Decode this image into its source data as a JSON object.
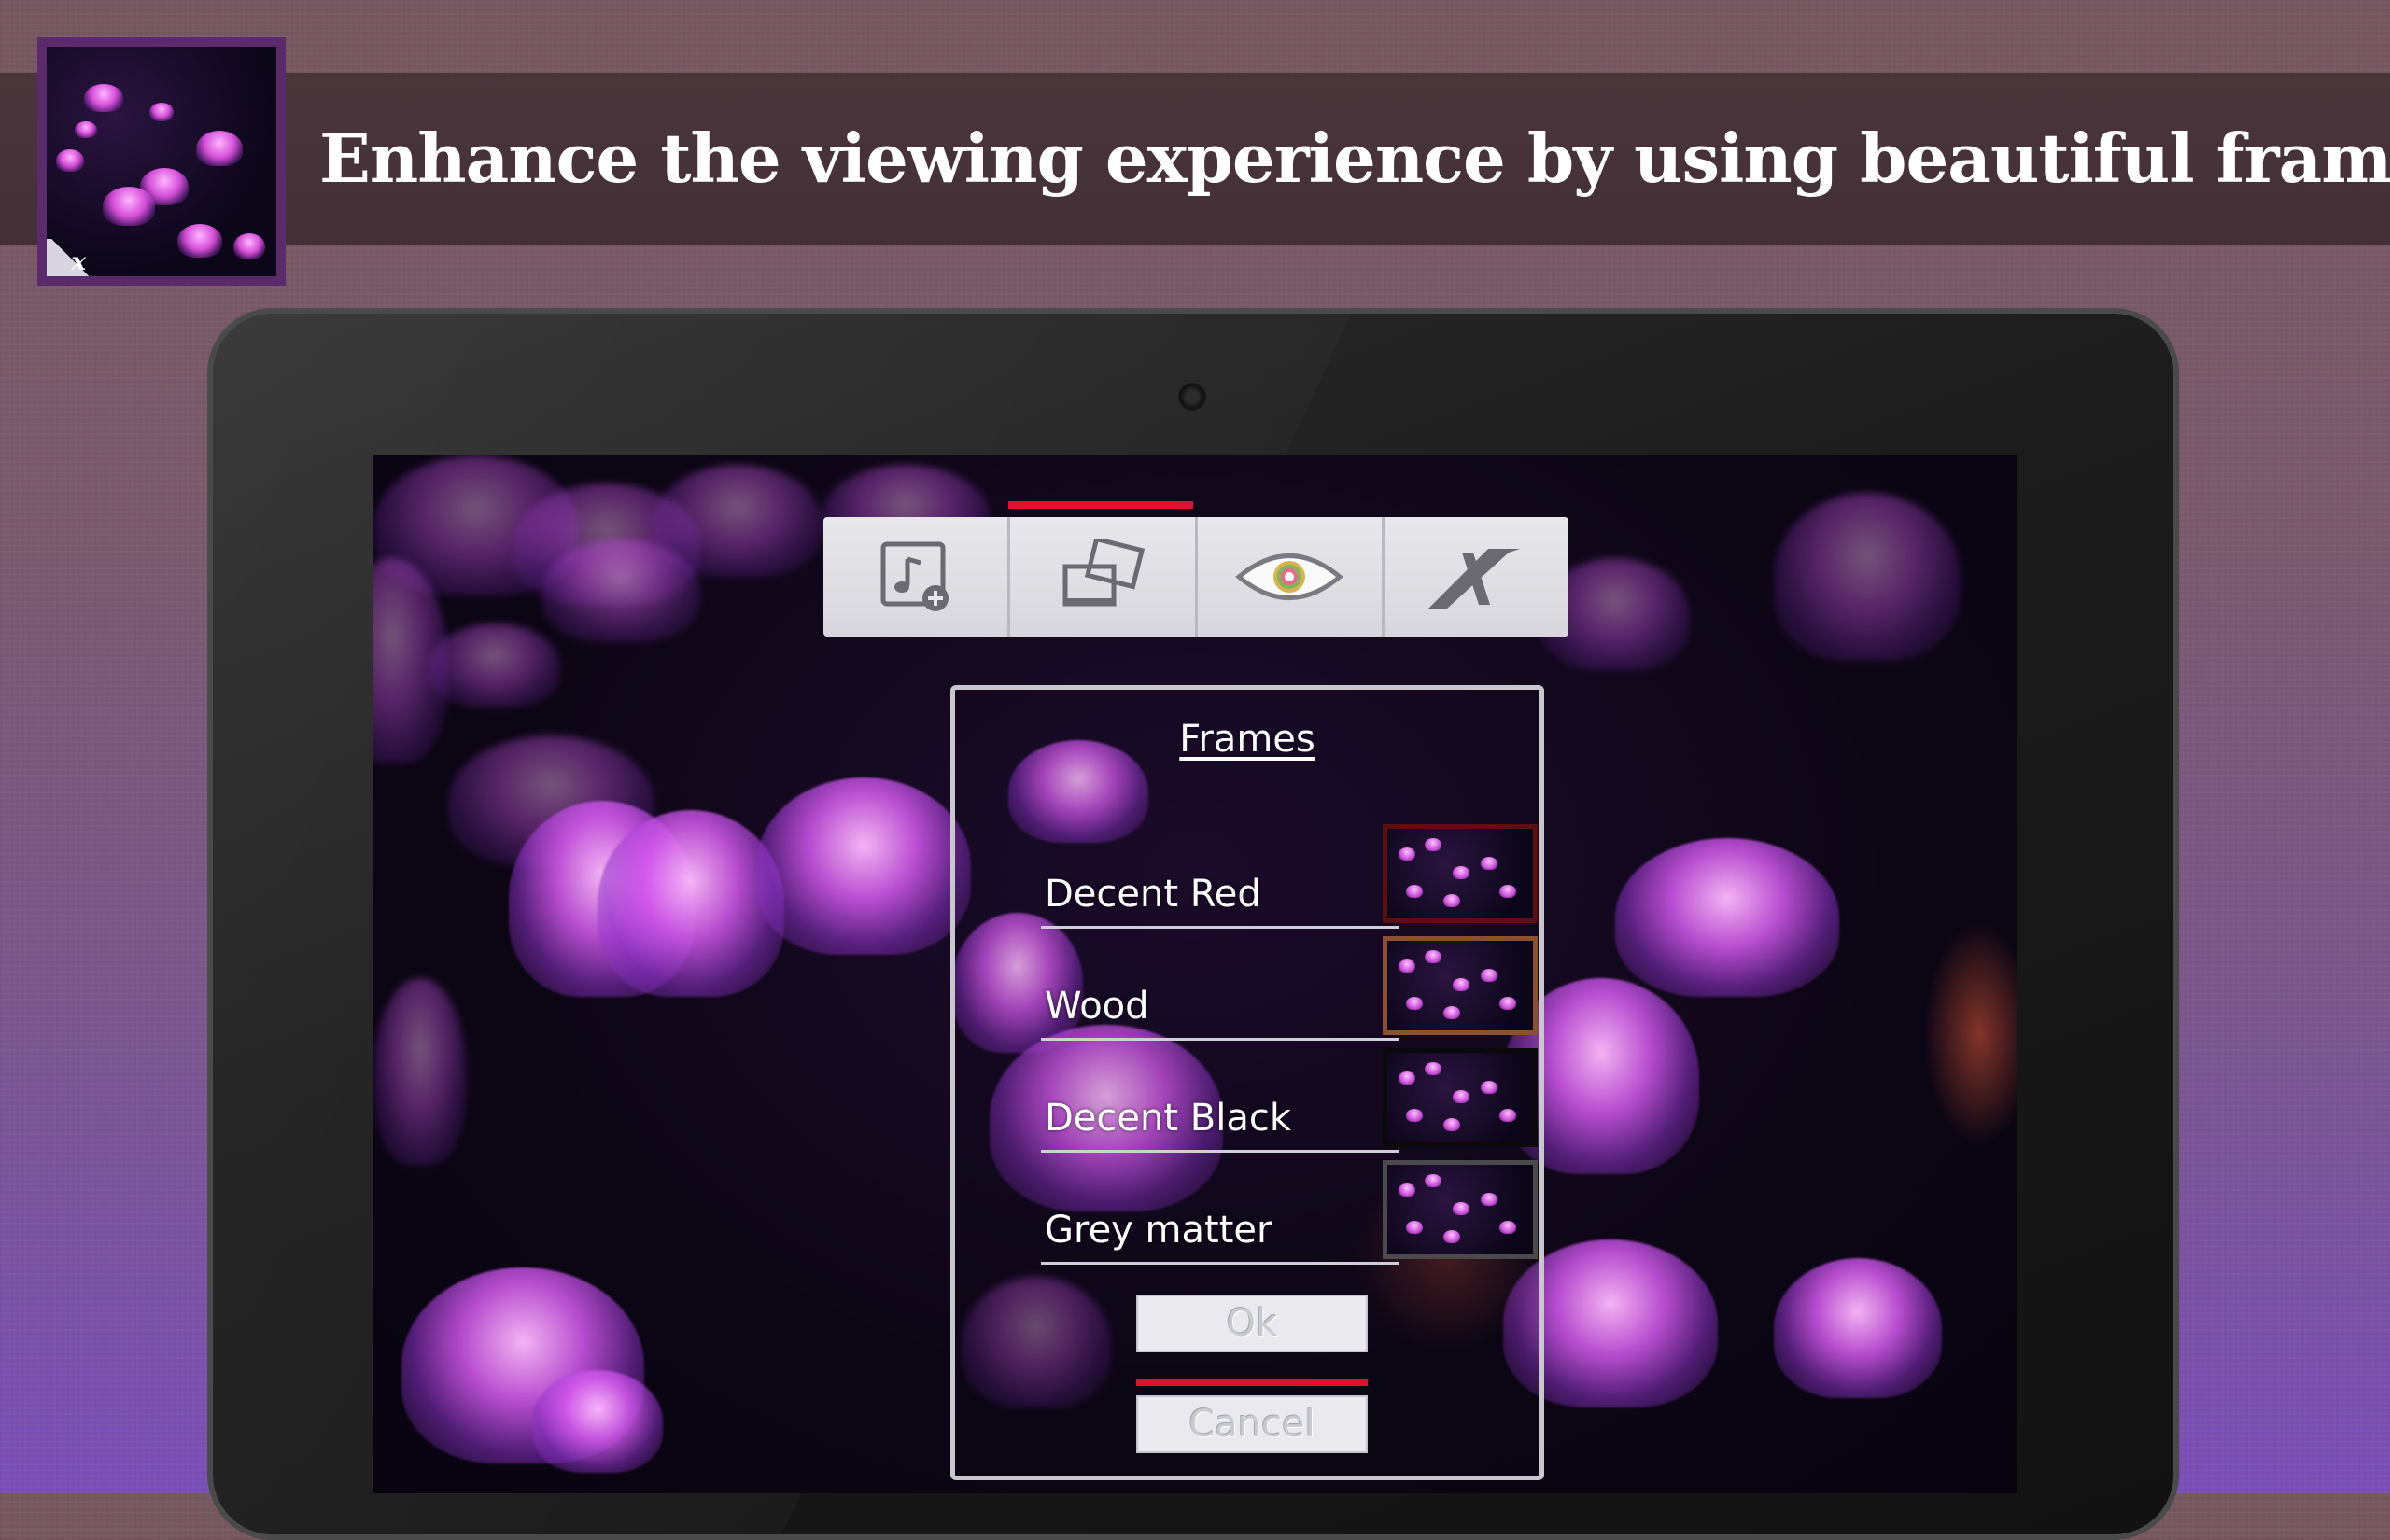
{
  "banner": {
    "title": "Enhance the viewing experience by using beautiful frames"
  },
  "colors": {
    "accent": "#e01030",
    "banner_bg": "#463238",
    "toolbar_bg": "#e2e2e6"
  },
  "toolbar": {
    "items": [
      {
        "icon": "music-add-icon",
        "active": true
      },
      {
        "icon": "frames-icon",
        "active": false
      },
      {
        "icon": "eye-icon",
        "active": false
      },
      {
        "icon": "x-logo-icon",
        "active": false
      }
    ]
  },
  "dialog": {
    "title": "Frames",
    "options": [
      {
        "label": "Decent Red",
        "frame_color": "#5a1010"
      },
      {
        "label": "Wood",
        "frame_color": "#8a5030"
      },
      {
        "label": "Decent Black",
        "frame_color": "#0a0a0a"
      },
      {
        "label": "Grey matter",
        "frame_color": "#4a4a4a"
      }
    ],
    "ok_label": "Ok",
    "cancel_label": "Cancel"
  }
}
